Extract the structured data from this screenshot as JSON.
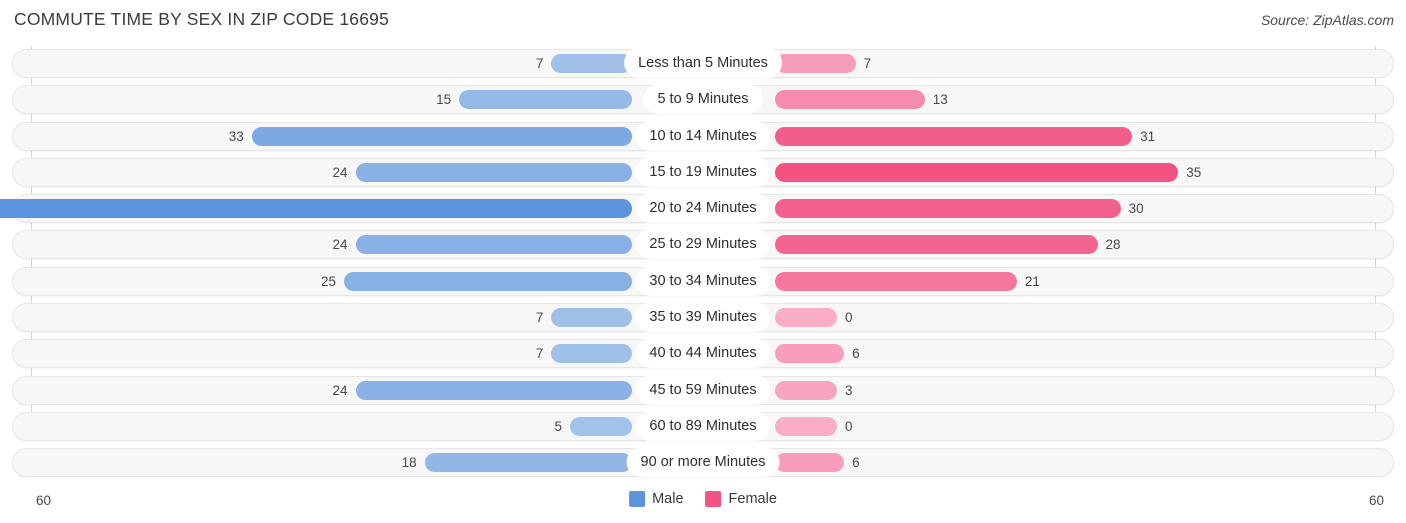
{
  "header": {
    "title": "COMMUTE TIME BY SEX IN ZIP CODE 16695",
    "source": "Source: ZipAtlas.com"
  },
  "legend": {
    "male_label": "Male",
    "female_label": "Female",
    "male_color": "#5b93dc",
    "female_color": "#f25383"
  },
  "axis": {
    "left_min": "60",
    "right_min": "60",
    "max": 60
  },
  "chart_data": {
    "type": "bar",
    "title": "COMMUTE TIME BY SEX IN ZIP CODE 16695",
    "subtitle": "Source: ZipAtlas.com",
    "orientation": "horizontal-diverging",
    "xlabel": "",
    "ylabel": "",
    "xlim": [
      60,
      60
    ],
    "grid": true,
    "legend_position": "bottom-center",
    "categories": [
      "Less than 5 Minutes",
      "5 to 9 Minutes",
      "10 to 14 Minutes",
      "15 to 19 Minutes",
      "20 to 24 Minutes",
      "25 to 29 Minutes",
      "30 to 34 Minutes",
      "35 to 39 Minutes",
      "40 to 44 Minutes",
      "45 to 59 Minutes",
      "60 to 89 Minutes",
      "90 or more Minutes"
    ],
    "series": [
      {
        "name": "Male",
        "values": [
          7,
          15,
          33,
          24,
          59,
          24,
          25,
          7,
          7,
          24,
          5,
          18
        ]
      },
      {
        "name": "Female",
        "values": [
          7,
          13,
          31,
          35,
          30,
          28,
          21,
          0,
          6,
          3,
          0,
          6
        ]
      }
    ]
  },
  "rows": [
    {
      "label": "Less than 5 Minutes",
      "male": "7",
      "female": "7"
    },
    {
      "label": "5 to 9 Minutes",
      "male": "15",
      "female": "13"
    },
    {
      "label": "10 to 14 Minutes",
      "male": "33",
      "female": "31"
    },
    {
      "label": "15 to 19 Minutes",
      "male": "24",
      "female": "35"
    },
    {
      "label": "20 to 24 Minutes",
      "male": "59",
      "female": "30"
    },
    {
      "label": "25 to 29 Minutes",
      "male": "24",
      "female": "28"
    },
    {
      "label": "30 to 34 Minutes",
      "male": "25",
      "female": "21"
    },
    {
      "label": "35 to 39 Minutes",
      "male": "7",
      "female": "0"
    },
    {
      "label": "40 to 44 Minutes",
      "male": "7",
      "female": "6"
    },
    {
      "label": "45 to 59 Minutes",
      "male": "24",
      "female": "3"
    },
    {
      "label": "60 to 89 Minutes",
      "male": "5",
      "female": "0"
    },
    {
      "label": "90 or more Minutes",
      "male": "18",
      "female": "6"
    }
  ]
}
